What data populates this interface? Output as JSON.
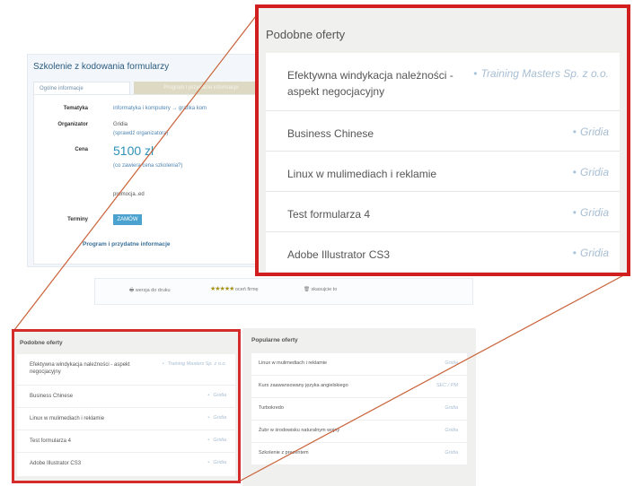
{
  "course": {
    "title": "Szkolenie z kodowania formularzy",
    "tabs": [
      "Ogólne informacje",
      "Program i przydatne informacje"
    ],
    "rows": {
      "topic_label": "Tematyka",
      "topic_value": "informatyka i komputery → grafika kom",
      "organizer_label": "Organizator",
      "organizer_value": "Gridia",
      "organizer_link": "(sprawdź organizatora)",
      "price_label": "Cena",
      "price_value": "5100 zł",
      "price_note": "(co zawiera cena szkolenia?)",
      "promo": "promocja..ed",
      "dates_label": "Terminy",
      "order_button": "ZAMÓW",
      "program_link": "Program i przydatne informacje"
    }
  },
  "actions": {
    "print": "wersja do druku",
    "rate": "oceń firmę",
    "stars": "★★★★★",
    "save": "skasujcie to"
  },
  "popular": {
    "title": "Popularne oferty",
    "items": [
      {
        "title": "Linux w mulimediach i reklamie",
        "provider": "Gridia"
      },
      {
        "title": "Kurs zaawansowany języka angielskiego",
        "provider": "SEC / PM"
      },
      {
        "title": "Turbokredo",
        "provider": "Gridia"
      },
      {
        "title": "Żubr w środowisku naturalnym wojny",
        "provider": "Gridia"
      },
      {
        "title": "Szkolenie z prezentem",
        "provider": "Gridia"
      }
    ]
  },
  "similar": {
    "title": "Podobne oferty",
    "items": [
      {
        "title": "Efektywna windykacja należności - aspekt negocjacyjny",
        "provider": "Training Masters Sp. z o.o."
      },
      {
        "title": "Business Chinese",
        "provider": "Gridia"
      },
      {
        "title": "Linux w mulimediach i reklamie",
        "provider": "Gridia"
      },
      {
        "title": "Test formularza 4",
        "provider": "Gridia"
      },
      {
        "title": "Adobe Illustrator CS3",
        "provider": "Gridia"
      }
    ]
  },
  "colors": {
    "highlight": "#d11f1f",
    "link": "#2e91b8",
    "provider": "#a8bed3"
  }
}
